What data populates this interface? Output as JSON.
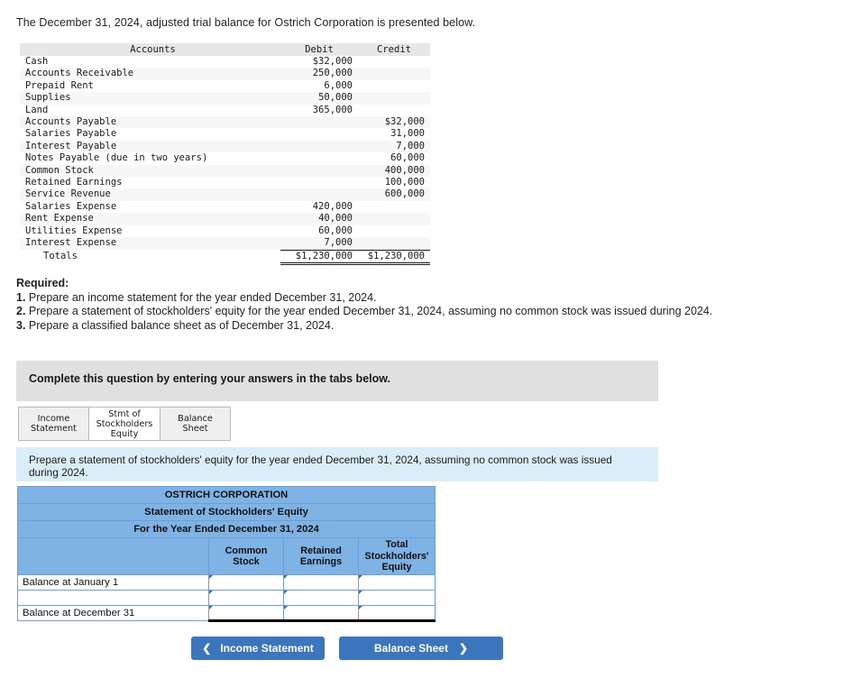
{
  "intro": "The December 31, 2024, adjusted trial balance for Ostrich Corporation is presented below.",
  "trial_balance": {
    "headers": {
      "accounts": "Accounts",
      "debit": "Debit",
      "credit": "Credit"
    },
    "rows": [
      {
        "account": "Cash",
        "debit": "$32,000",
        "credit": ""
      },
      {
        "account": "Accounts Receivable",
        "debit": "250,000",
        "credit": ""
      },
      {
        "account": "Prepaid Rent",
        "debit": "6,000",
        "credit": ""
      },
      {
        "account": "Supplies",
        "debit": "50,000",
        "credit": ""
      },
      {
        "account": "Land",
        "debit": "365,000",
        "credit": ""
      },
      {
        "account": "Accounts Payable",
        "debit": "",
        "credit": "$32,000"
      },
      {
        "account": "Salaries Payable",
        "debit": "",
        "credit": "31,000"
      },
      {
        "account": "Interest Payable",
        "debit": "",
        "credit": "7,000"
      },
      {
        "account": "Notes Payable (due in two years)",
        "debit": "",
        "credit": "60,000"
      },
      {
        "account": "Common Stock",
        "debit": "",
        "credit": "400,000"
      },
      {
        "account": "Retained Earnings",
        "debit": "",
        "credit": "100,000"
      },
      {
        "account": "Service Revenue",
        "debit": "",
        "credit": "600,000"
      },
      {
        "account": "Salaries Expense",
        "debit": "420,000",
        "credit": ""
      },
      {
        "account": "Rent Expense",
        "debit": "40,000",
        "credit": ""
      },
      {
        "account": "Utilities Expense",
        "debit": "60,000",
        "credit": ""
      },
      {
        "account": "Interest Expense",
        "debit": "7,000",
        "credit": ""
      }
    ],
    "totals": {
      "label": "Totals",
      "debit": "$1,230,000",
      "credit": "$1,230,000"
    }
  },
  "required": {
    "heading": "Required:",
    "item1_num": "1.",
    "item1_text": " Prepare an income statement for the year ended December 31, 2024.",
    "item2_num": "2.",
    "item2_text": " Prepare a statement of stockholders' equity for the year ended December 31, 2024, assuming no common stock was issued during 2024.",
    "item3_num": "3.",
    "item3_text": " Prepare a classified balance sheet as of December 31, 2024."
  },
  "gray_banner": {
    "text": "Complete this question by entering your answers in the tabs below."
  },
  "tabs": [
    {
      "label": "Income\nStatement",
      "active": false
    },
    {
      "label": "Stmt of\nStockholders\nEquity",
      "active": true
    },
    {
      "label": "Balance Sheet",
      "active": false
    }
  ],
  "blue_banner": {
    "text": "Prepare a statement of stockholders' equity for the year ended December 31, 2024, assuming no common stock was issued during 2024."
  },
  "answer_table": {
    "title_line1": "OSTRICH CORPORATION",
    "title_line2": "Statement of Stockholders' Equity",
    "title_line3": "For the Year Ended December 31, 2024",
    "col_headers": {
      "blank": "",
      "common_stock": "Common\nStock",
      "retained_earnings": "Retained\nEarnings",
      "total_equity": "Total\nStockholders'\nEquity"
    },
    "rows": [
      {
        "label": "Balance at January 1",
        "common_stock": "",
        "retained_earnings": "",
        "total_equity": ""
      },
      {
        "label": "",
        "common_stock": "",
        "retained_earnings": "",
        "total_equity": ""
      },
      {
        "label": "Balance at December 31",
        "common_stock": "",
        "retained_earnings": "",
        "total_equity": ""
      }
    ]
  },
  "nav": {
    "prev_label": "Income Statement",
    "prev_chevron": "❮",
    "next_label": "Balance Sheet",
    "next_chevron": "❯"
  },
  "colors": {
    "header_blue": "#7fb2e5",
    "banner_gray": "#e0e0e0",
    "banner_blue": "#daeef8",
    "button_blue": "#3b76bc",
    "table_border_blue": "#6f9fd0"
  }
}
